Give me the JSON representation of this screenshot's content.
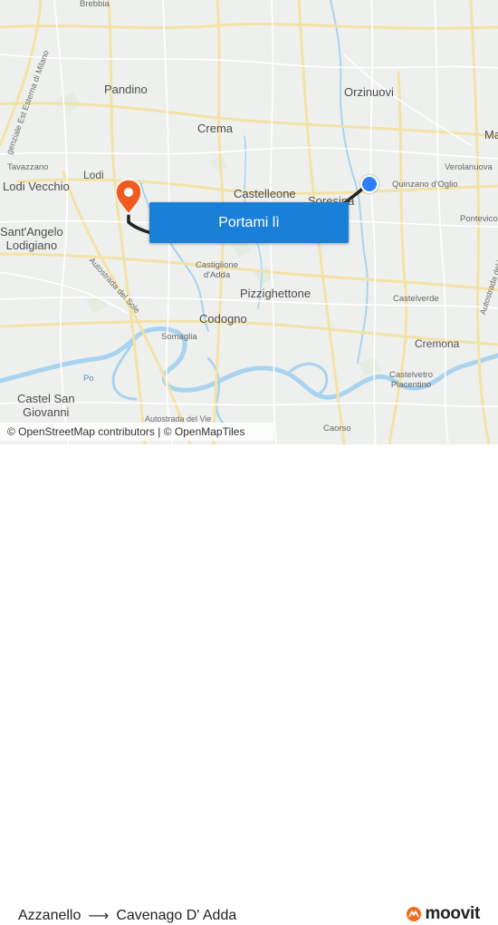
{
  "map": {
    "places": [
      {
        "id": "brebbia",
        "text": "Brebbia"
      },
      {
        "id": "pandino",
        "text": "Pandino"
      },
      {
        "id": "orzinuovi",
        "text": "Orzinuovi"
      },
      {
        "id": "crema",
        "text": "Crema"
      },
      {
        "id": "ma",
        "text": "Ma"
      },
      {
        "id": "verolanuova",
        "text": "Verolanuova"
      },
      {
        "id": "tavazzano",
        "text": "Tavazzano"
      },
      {
        "id": "lodi",
        "text": "Lodi"
      },
      {
        "id": "lodi_vecchio",
        "text": "Lodi Vecchio"
      },
      {
        "id": "castelleone",
        "text": "Castelleone"
      },
      {
        "id": "soresina",
        "text": "Soresina"
      },
      {
        "id": "quinzano",
        "text": "Quinzano d'Oglio"
      },
      {
        "id": "pontevico",
        "text": "Pontevico"
      },
      {
        "id": "santangelo",
        "text": "Sant'Angelo\nLodigiano"
      },
      {
        "id": "castiglione",
        "text": "Castiglione\nd'Adda"
      },
      {
        "id": "pizzighettone",
        "text": "Pizzighettone"
      },
      {
        "id": "castelverde",
        "text": "Castelverde"
      },
      {
        "id": "codogno",
        "text": "Codogno"
      },
      {
        "id": "cremona",
        "text": "Cremona"
      },
      {
        "id": "somaglia",
        "text": "Somaglia"
      },
      {
        "id": "castelvetro",
        "text": "Castelvetro\nPiacentino"
      },
      {
        "id": "castel_san_giovanni",
        "text": "Castel San\nGiovanni"
      },
      {
        "id": "caorso",
        "text": "Caorso"
      },
      {
        "id": "po",
        "text": "Po"
      }
    ],
    "road_labels": [
      {
        "id": "tangenziale",
        "text": "genziale Est Esterna di Milano"
      },
      {
        "id": "autostrada_sole",
        "text": "Autostrada del Sole"
      },
      {
        "id": "autostrada_vie",
        "text": "Autostrada del Vie"
      },
      {
        "id": "autostrada_bottom",
        "text": "Autostrada del Vie"
      }
    ],
    "attribution": "© OpenStreetMap contributors | © OpenMapTiles",
    "cta_label": "Portami lì",
    "colors": {
      "route": "#222222",
      "origin": "#2d7ff9",
      "destination": "#f05a1f",
      "cta": "#1a7fd6",
      "water": "#a9d3ee"
    }
  },
  "footer": {
    "origin": "Azzanello",
    "destination": "Cavenago D' Adda",
    "brand": "moovit"
  }
}
